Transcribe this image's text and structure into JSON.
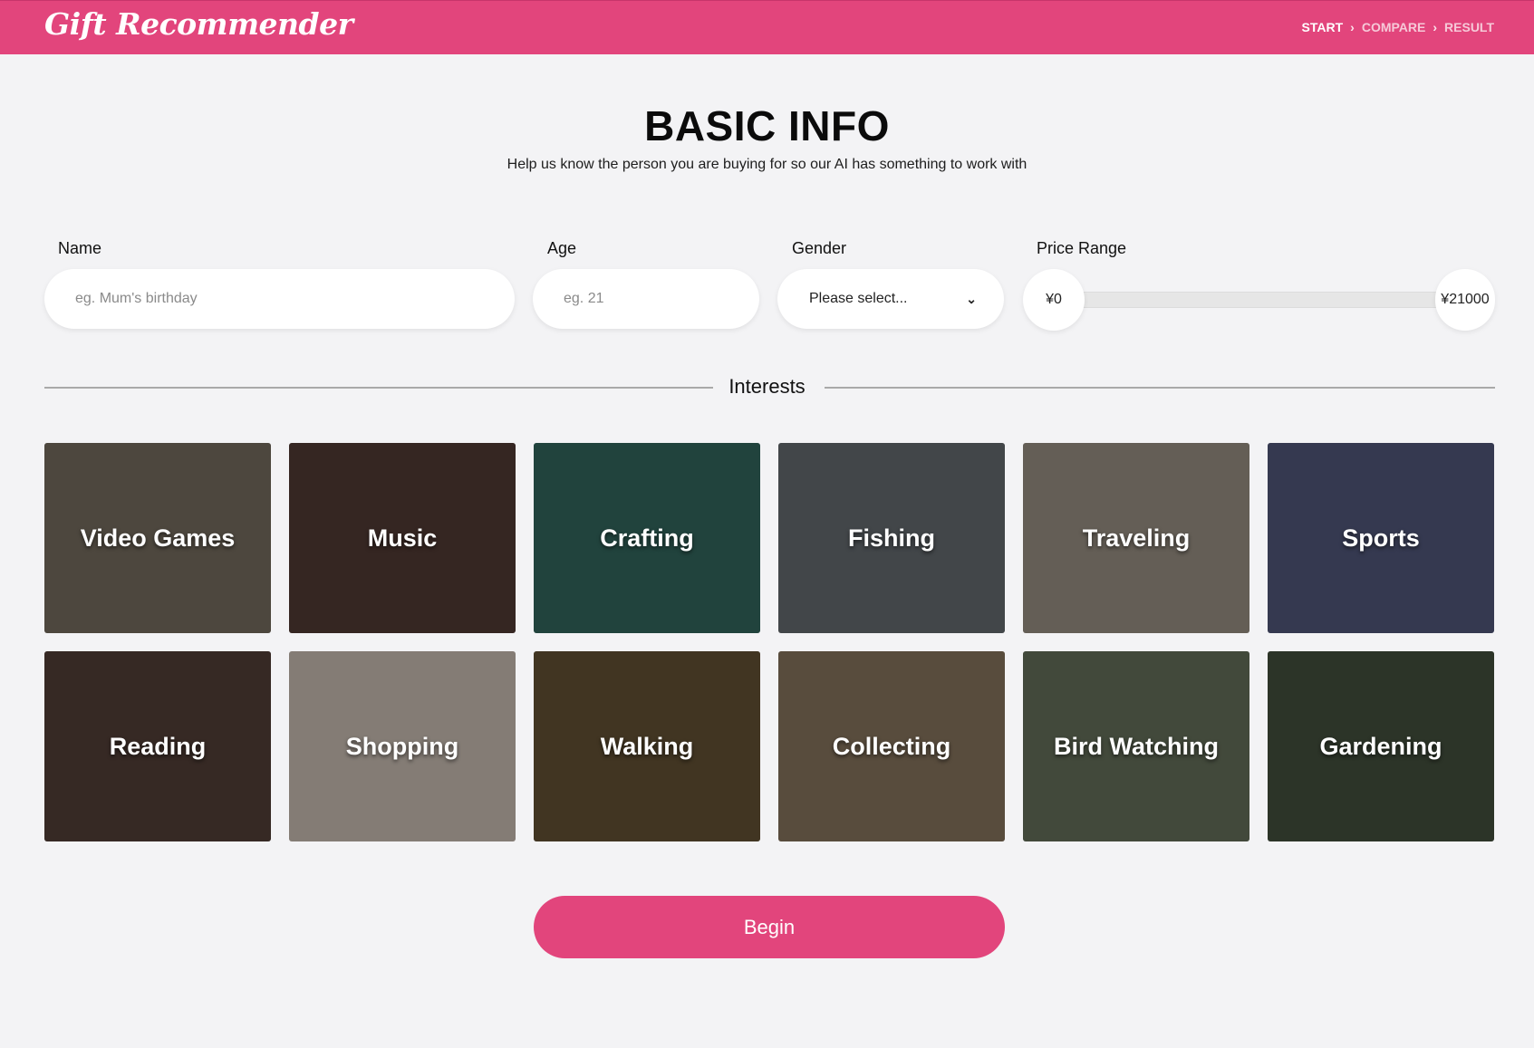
{
  "header": {
    "brand": "Gift Recommender",
    "steps": [
      {
        "label": "START",
        "active": true
      },
      {
        "label": "COMPARE",
        "active": false
      },
      {
        "label": "RESULT",
        "active": false
      }
    ],
    "step_separator": "›"
  },
  "page": {
    "title": "BASIC INFO",
    "subtitle": "Help us know the person you are buying for so our AI has something to work with"
  },
  "form": {
    "name": {
      "label": "Name",
      "placeholder": "eg. Mum's birthday"
    },
    "age": {
      "label": "Age",
      "placeholder": "eg. 21"
    },
    "gender": {
      "label": "Gender",
      "selected": "Please select..."
    },
    "price_range": {
      "label": "Price Range",
      "min": "¥0",
      "max": "¥21000"
    }
  },
  "interests": {
    "heading": "Interests",
    "items": [
      {
        "label": "Video Games",
        "bg": "#6b6357"
      },
      {
        "label": "Music",
        "bg": "#4a3530"
      },
      {
        "label": "Crafting",
        "bg": "#2e5e55"
      },
      {
        "label": "Fishing",
        "bg": "#5c6166"
      },
      {
        "label": "Traveling",
        "bg": "#8b8378"
      },
      {
        "label": "Sports",
        "bg": "#4a5070"
      },
      {
        "label": "Reading",
        "bg": "#4b3a32"
      },
      {
        "label": "Shopping",
        "bg": "#b8aca3"
      },
      {
        "label": "Walking",
        "bg": "#5a4a30"
      },
      {
        "label": "Collecting",
        "bg": "#7a6a55"
      },
      {
        "label": "Bird Watching",
        "bg": "#5c6652"
      },
      {
        "label": "Gardening",
        "bg": "#3d4838"
      }
    ]
  },
  "actions": {
    "begin_label": "Begin"
  },
  "colors": {
    "accent": "#e2457c",
    "background": "#f3f3f5"
  }
}
